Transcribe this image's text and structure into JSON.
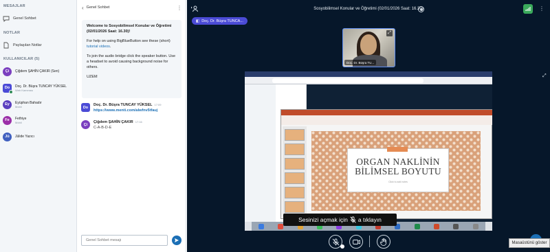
{
  "sidebar": {
    "messages_heading": "MESAJLAR",
    "public_chat_label": "Genel Sohbet",
    "notes_heading": "NOTLAR",
    "shared_notes_label": "Paylaşılan Notlar",
    "users_heading": "KULLANICILAR (5)",
    "users": [
      {
        "initials": "Çi",
        "name": "Çiğdem ŞAHİN ÇAKIR (Sen)",
        "sub": "",
        "color": "#7b3fbf"
      },
      {
        "initials": "Do",
        "name": "Doç. Dr. Büşra TUNCAY YÜKSEL",
        "sub": "Web Kamerası",
        "color": "#4b4bd6"
      },
      {
        "initials": "Ey",
        "name": "Eyüphan Bahadır",
        "sub": "Mobil",
        "color": "#5a3fbf"
      },
      {
        "initials": "Fe",
        "name": "Fethiye",
        "sub": "Mobil",
        "color": "#9b2fa8"
      },
      {
        "initials": "Jü",
        "name": "Jülide Yazıcı",
        "sub": "",
        "color": "#3f5fbf"
      }
    ]
  },
  "chat": {
    "title": "Genel Sohbet",
    "welcome": {
      "line1": "Welcome to Sosyobilimsel Konular ve Öğretimi (02/01/2026 Saat: 16.30)!",
      "help_prefix": "For help on using BigBlueButton see these (short) ",
      "help_link": "tutorial videos",
      "help_suffix": ".",
      "audio": "To join the audio bridge click the speaker button. Use a headset to avoid causing background noise for others.",
      "sign": "UZEM"
    },
    "messages": [
      {
        "initials": "Do",
        "sender": "Doç. Dr. Büşra TUNCAY YÜKSEL",
        "time": "17:09",
        "text": "https://www.menti.com/alwfnv5tfauj",
        "color": "#4b4bd6"
      },
      {
        "initials": "Çi",
        "sender": "Çiğdem ŞAHİN ÇAKIR",
        "time": "17:16",
        "text": "C-A-B-D-E",
        "color": "#7b3fbf"
      }
    ],
    "input_placeholder": "Genel Sohbet mesajı"
  },
  "main": {
    "meeting_title": "Sosyobilimsel Konular ve Öğretimi (02/01/2026 Saat: 16.30)",
    "presenter_label": "Doç. Dr. Büşra TUNCA...",
    "webcam_label": "Doç. Dr. Büşra TU...",
    "slide_title": "ORGAN NAKLİNİN BİLİMSEL BOYUTU",
    "slide_subtitle": "Click to add notes",
    "caption_prefix": "Sesinizi açmak için",
    "caption_suffix": "a tıklayın",
    "desktop_tooltip": "Masaüstünü göster"
  },
  "icons": {
    "back": "chevron-left-icon",
    "kebab": "more-vertical-icon",
    "send": "send-icon",
    "mic_off": "mic-off-icon",
    "camera": "camera-icon",
    "raise_hand": "hand-icon"
  },
  "colors": {
    "accent": "#1b6fb5",
    "presenter": "#4b4bd6",
    "connection": "#3aa95b",
    "main_bg": "#06172a"
  }
}
